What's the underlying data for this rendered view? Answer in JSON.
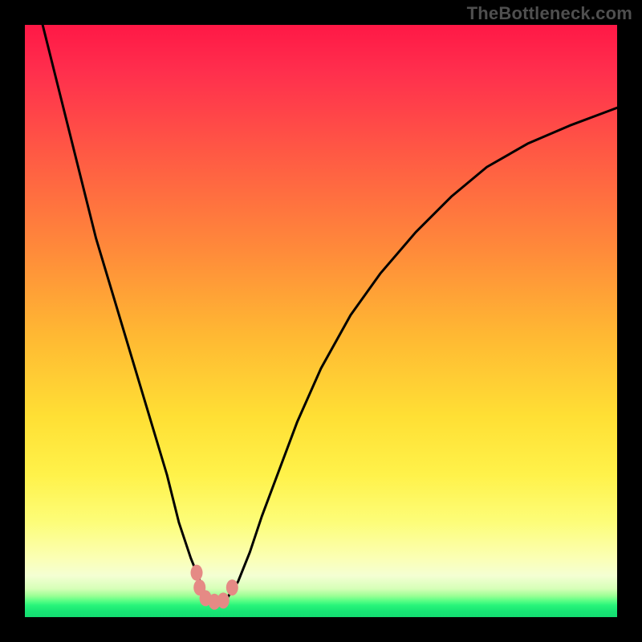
{
  "watermark": "TheBottleneck.com",
  "chart_data": {
    "type": "line",
    "title": "",
    "xlabel": "",
    "ylabel": "",
    "xlim": [
      0,
      100
    ],
    "ylim": [
      0,
      100
    ],
    "grid": false,
    "series": [
      {
        "name": "curve",
        "x": [
          3,
          6,
          9,
          12,
          15,
          18,
          21,
          24,
          26,
          28,
          30,
          31,
          32,
          33,
          34,
          36,
          38,
          40,
          43,
          46,
          50,
          55,
          60,
          66,
          72,
          78,
          85,
          92,
          100
        ],
        "values": [
          100,
          88,
          76,
          64,
          54,
          44,
          34,
          24,
          16,
          10,
          5,
          3,
          2.5,
          2.5,
          3,
          6,
          11,
          17,
          25,
          33,
          42,
          51,
          58,
          65,
          71,
          76,
          80,
          83,
          86
        ]
      }
    ],
    "markers": [
      {
        "name": "dot-left-upper",
        "x": 29.0,
        "y": 7.5
      },
      {
        "name": "dot-left-mid",
        "x": 29.5,
        "y": 5.0
      },
      {
        "name": "dot-bottom-1",
        "x": 30.5,
        "y": 3.2
      },
      {
        "name": "dot-bottom-2",
        "x": 32.0,
        "y": 2.6
      },
      {
        "name": "dot-bottom-3",
        "x": 33.5,
        "y": 2.8
      },
      {
        "name": "dot-right",
        "x": 35.0,
        "y": 5.0
      }
    ],
    "colors": {
      "curve": "#000000",
      "markers": "#e58a85"
    }
  }
}
